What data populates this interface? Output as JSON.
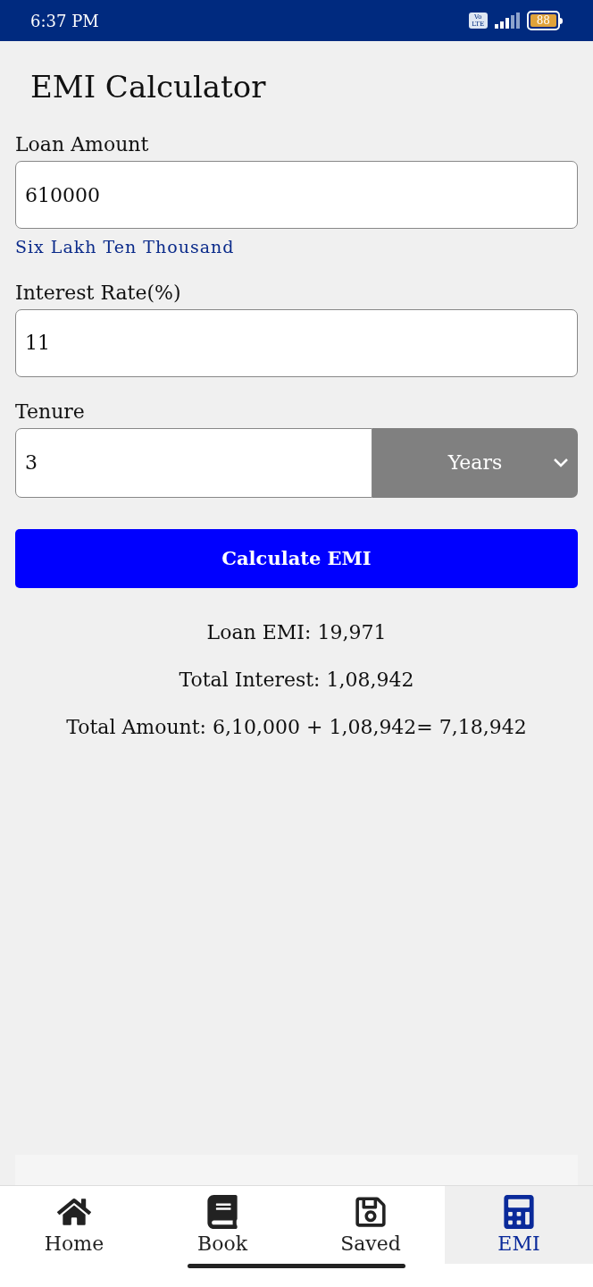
{
  "status_bar": {
    "time": "6:37 PM",
    "network": "Vo LTE",
    "battery": "88"
  },
  "title": "EMI Calculator",
  "loan_amount": {
    "label": "Loan Amount",
    "value": "610000",
    "in_words": "Six Lakh Ten Thousand"
  },
  "interest_rate": {
    "label": "Interest Rate(%)",
    "value": "11"
  },
  "tenure": {
    "label": "Tenure",
    "value": "3",
    "unit": "Years"
  },
  "calculate_button": "Calculate EMI",
  "results": [
    "Loan EMI: 19,971",
    "Total Interest: 1,08,942",
    "Total Amount: 6,10,000 + 1,08,942= 7,18,942"
  ],
  "bottom_nav": [
    {
      "label": "Home",
      "selected": false
    },
    {
      "label": "Book",
      "selected": false
    },
    {
      "label": "Saved",
      "selected": false
    },
    {
      "label": "EMI",
      "selected": true
    }
  ]
}
